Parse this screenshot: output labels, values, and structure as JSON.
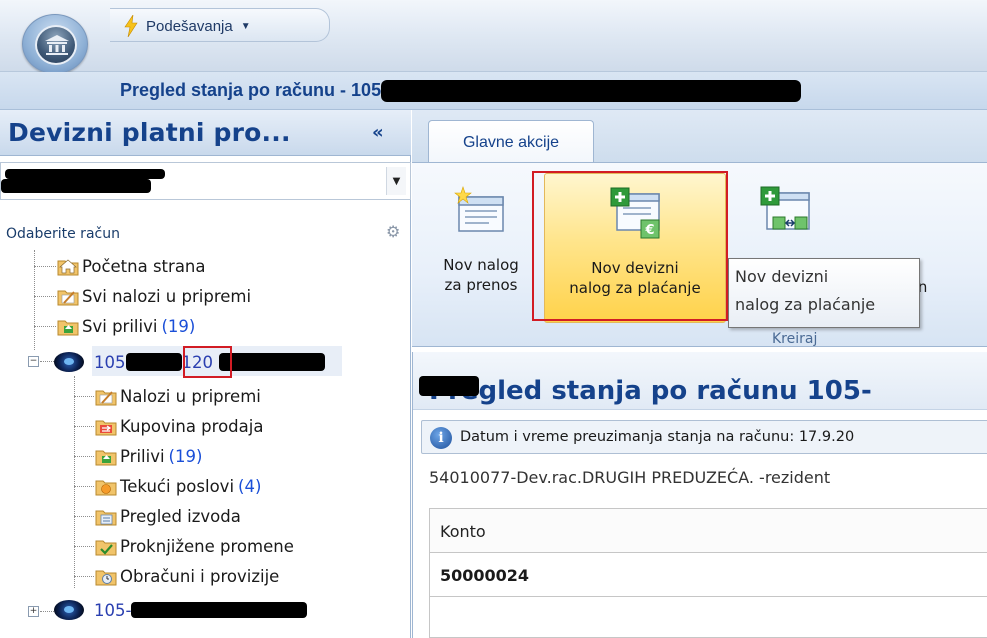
{
  "titlebar": {
    "settings_label": "Podešavanja",
    "subtitle_prefix": "Pregled stanja po računu - 105-"
  },
  "left_panel": {
    "title": "Devizni platni pro...",
    "collapse_glyph": "«",
    "choose_account_label": "Odaberite račun",
    "tree": [
      {
        "label": "Početna strana",
        "icon": "home-folder-icon"
      },
      {
        "label": "Svi nalozi u pripremi",
        "icon": "edit-folder-icon"
      },
      {
        "label": "Svi prilivi",
        "count": "(19)",
        "icon": "inflow-folder-icon"
      },
      {
        "account_prefix": "105",
        "count": "120",
        "icon": "account-globe-icon"
      },
      {
        "label": "Nalozi u pripremi",
        "icon": "edit-folder-icon"
      },
      {
        "label": "Kupovina prodaja",
        "icon": "exchange-folder-icon"
      },
      {
        "label": "Prilivi",
        "count": "(19)",
        "icon": "inflow-folder-icon"
      },
      {
        "label": "Tekući poslovi",
        "count": "(4)",
        "icon": "current-folder-icon"
      },
      {
        "label": "Pregled izvoda",
        "icon": "statement-folder-icon"
      },
      {
        "label": "Proknjižene promene",
        "icon": "posted-folder-icon"
      },
      {
        "label": "Obračuni i provizije",
        "icon": "fees-folder-icon"
      },
      {
        "account_prefix": "105-",
        "icon": "account-globe-icon"
      }
    ]
  },
  "ribbon": {
    "tab_label": "Glavne akcije",
    "buttons": [
      {
        "line1": "Nov nalog",
        "line2": "za prenos"
      },
      {
        "line1": "Nov devizni",
        "line2": "nalog za plaćanje"
      },
      {
        "line1": "",
        "line2": "a tran"
      }
    ],
    "group_caption": "Kreiraj",
    "tooltip_line1": "Nov devizni",
    "tooltip_line2": "nalog za plaćanje"
  },
  "content": {
    "title": "Pregled stanja po računu 105-",
    "info_text": "Datum i vreme preuzimanja stanja na računu: 17.9.20",
    "account_description": "54010077-Dev.rac.DRUGIH PREDUZEĆA. -rezident",
    "grid_header": "Konto",
    "grid_value": "50000024"
  },
  "colors": {
    "accent_blue": "#15428b",
    "highlight_red": "#d21c24",
    "button_highlight": "#ffd24a",
    "count_blue": "#1a4fd8"
  }
}
